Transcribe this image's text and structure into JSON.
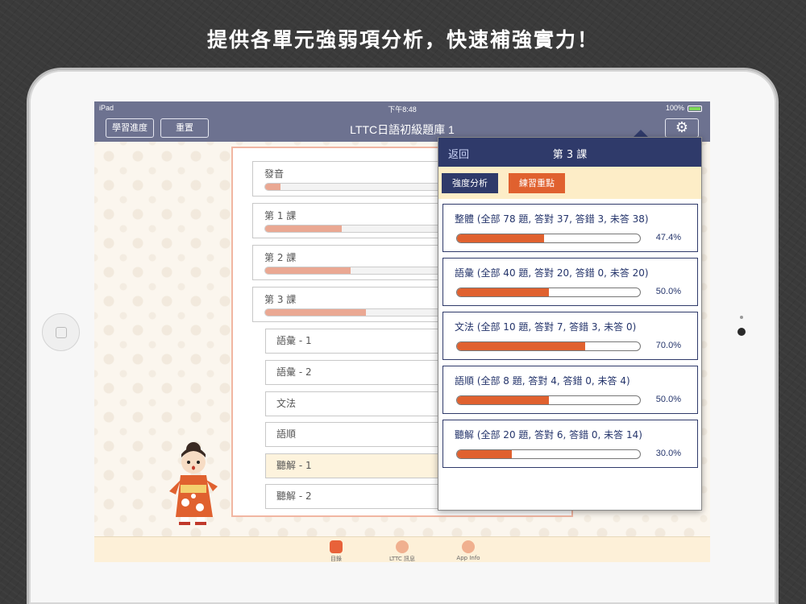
{
  "headline": "提供各單元強弱項分析，快速補強實力！",
  "statusbar": {
    "carrier": "iPad",
    "time": "下午8:48",
    "battery": "100%"
  },
  "navbar": {
    "progress_button": "學習進度",
    "reset_button": "重置",
    "title": "LTTC日語初級題庫 1",
    "settings_icon": "gear-icon"
  },
  "list": {
    "rows": [
      {
        "label": "發音",
        "progress": 0.05
      },
      {
        "label": "第 1 課",
        "progress": 0.25
      },
      {
        "label": "第 2 課",
        "progress": 0.28
      },
      {
        "label": "第 3 課",
        "progress": 0.33
      }
    ],
    "subrows": [
      "語彙 - 1",
      "語彙 - 2",
      "文法",
      "語順",
      "聽解 - 1",
      "聽解 - 2"
    ],
    "selected_subrow": 4
  },
  "tabbar": [
    {
      "label": "目錄",
      "icon": "folder-icon",
      "active": true
    },
    {
      "label": "LTTC 訊息",
      "icon": "ribbon-icon",
      "active": false
    },
    {
      "label": "App Info",
      "icon": "info-icon",
      "active": false
    }
  ],
  "popover": {
    "back": "返回",
    "title": "第 3 課",
    "tabs": [
      {
        "label": "強度分析",
        "color": "#2f3a6a"
      },
      {
        "label": "練習重點",
        "color": "#e0612f"
      }
    ],
    "cards": [
      {
        "title": "整體 (全部 78 題, 答對 37, 答錯 3, 未答 38)",
        "percent": "47.4%",
        "value": 0.474
      },
      {
        "title": "語彙 (全部 40 題, 答對 20, 答錯 0, 未答 20)",
        "percent": "50.0%",
        "value": 0.5
      },
      {
        "title": "文法 (全部 10 題, 答對 7, 答錯 3, 未答 0)",
        "percent": "70.0%",
        "value": 0.7
      },
      {
        "title": "語順 (全部 8 題, 答對 4, 答錯 0, 未答 4)",
        "percent": "50.0%",
        "value": 0.5
      },
      {
        "title": "聽解 (全部 20 題, 答對 6, 答錯 0, 未答 14)",
        "percent": "30.0%",
        "value": 0.3
      }
    ]
  },
  "colors": {
    "navbar": "#6d7290",
    "popover_header": "#2f3a6a",
    "accent": "#e0612f"
  }
}
